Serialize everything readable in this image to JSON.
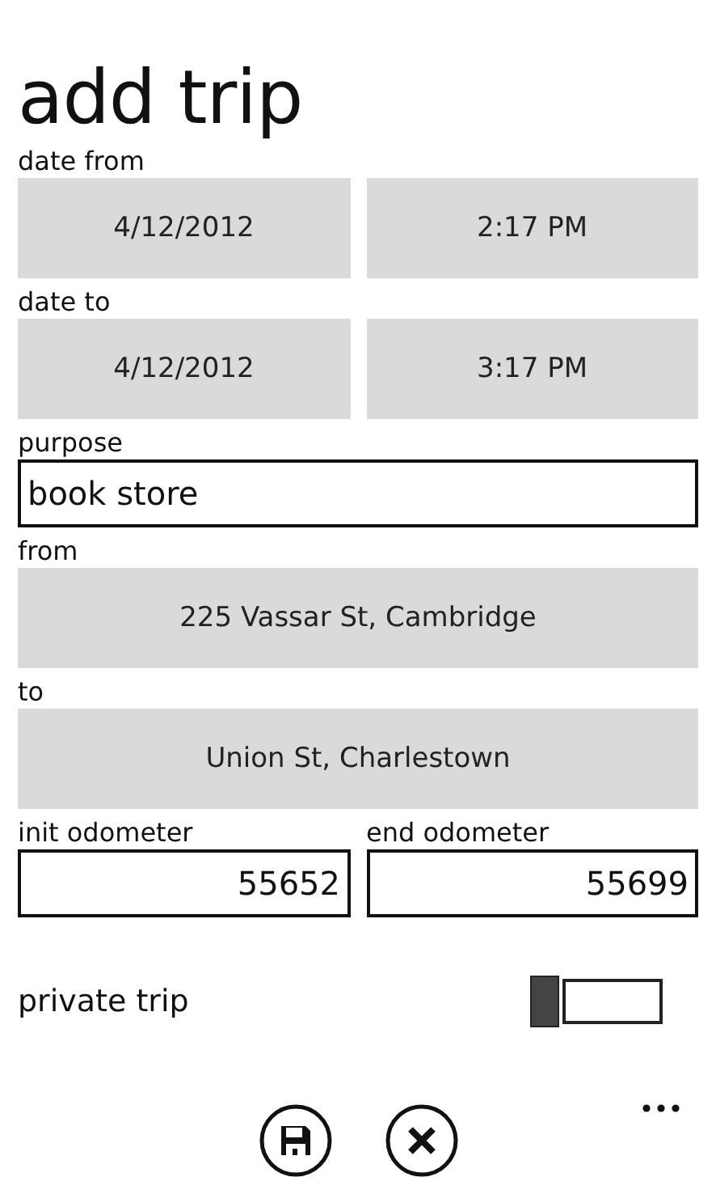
{
  "title": "add trip",
  "date_from": {
    "label": "date from",
    "date": "4/12/2012",
    "time": "2:17 PM"
  },
  "date_to": {
    "label": "date to",
    "date": "4/12/2012",
    "time": "3:17 PM"
  },
  "purpose": {
    "label": "purpose",
    "value": "book store"
  },
  "from": {
    "label": "from",
    "value": "225 Vassar St, Cambridge"
  },
  "to": {
    "label": "to",
    "value": "Union St, Charlestown"
  },
  "odometers": [
    {
      "label": "init odometer",
      "value": "55652"
    },
    {
      "label": "end odometer",
      "value": "55699"
    }
  ],
  "private_trip": {
    "label": "private trip",
    "on": false
  },
  "app_bar": [
    {
      "kind": "save"
    },
    {
      "kind": "cancel"
    }
  ]
}
